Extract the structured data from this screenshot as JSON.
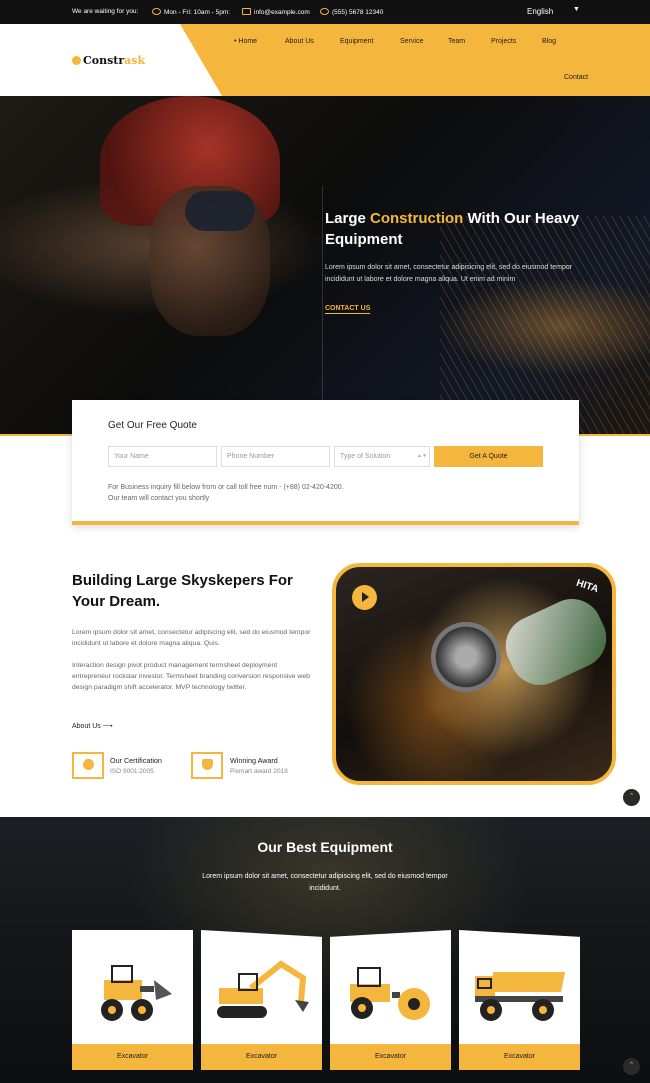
{
  "topbar": {
    "waiting": "We are waiting for you:",
    "hours": "Mon - Fri: 10am - 5pm:",
    "email": "info@example.com",
    "phone": "(555) 5678 12340",
    "language": "English"
  },
  "brand": {
    "logo_main": "Constr",
    "logo_accent": "ask"
  },
  "nav": {
    "home": "Home",
    "about": "About Us",
    "equipment": "Equipment",
    "service": "Service",
    "team": "Team",
    "projects": "Projects",
    "blog": "Blog",
    "contact": "Contact"
  },
  "hero": {
    "title_pre": "Large ",
    "title_hl": "Construction",
    "title_post": " With Our Heavy Equipment",
    "text": "Lorem ipsum dolor sit amet, consectetur adipisicing elit, sed do eiusmod tempor incididunt ut labore et dolore magna aliqua. Ut enim ad minim",
    "cta": "CONTACT US"
  },
  "quote": {
    "title": "Get Our Free Quote",
    "name_placeholder": "Your Name",
    "phone_placeholder": "Phone Number",
    "solution_placeholder": "Type of Solution",
    "button": "Get A Quote",
    "note_line1": "For Business inquiry fill below from or call toll free num - (+88) 02-420-4200.",
    "note_line2": "Our team will contact you shortly"
  },
  "about": {
    "title": "Building Large Skyskepers For Your Dream.",
    "para1": "Lorem ipsum dolor sit amet, consectetur adipiscing elit, sed do eiusmod tempor incididunt ut labore et dolore magna aliqua. Quis.",
    "para2": "Interaction design pivot product management termsheet deployment entrepreneur rockstar investor. Termsheet branding conversion responsive web design paradigm shift accelerator. MVP technology twitter.",
    "link": "About Us",
    "cert_title": "Our Certification",
    "cert_sub": "ISO 9001:2005",
    "award_title": "Winning Award",
    "award_sub": "Pixmart award 2018",
    "image_brand": "HITA"
  },
  "equipment": {
    "title": "Our Best Equipment",
    "subtitle": "Lorem ipsum dolor sit amet, consectetur adipiscing elit, sed do eiusmod tempor incididunt.",
    "cards": [
      {
        "label": "Excavator",
        "icon": "wheel-loader-icon"
      },
      {
        "label": "Excavator",
        "icon": "excavator-icon"
      },
      {
        "label": "Excavator",
        "icon": "road-roller-icon"
      },
      {
        "label": "Excavator",
        "icon": "dump-truck-icon"
      }
    ]
  },
  "colors": {
    "accent": "#f4b63c",
    "dark": "#111111"
  }
}
